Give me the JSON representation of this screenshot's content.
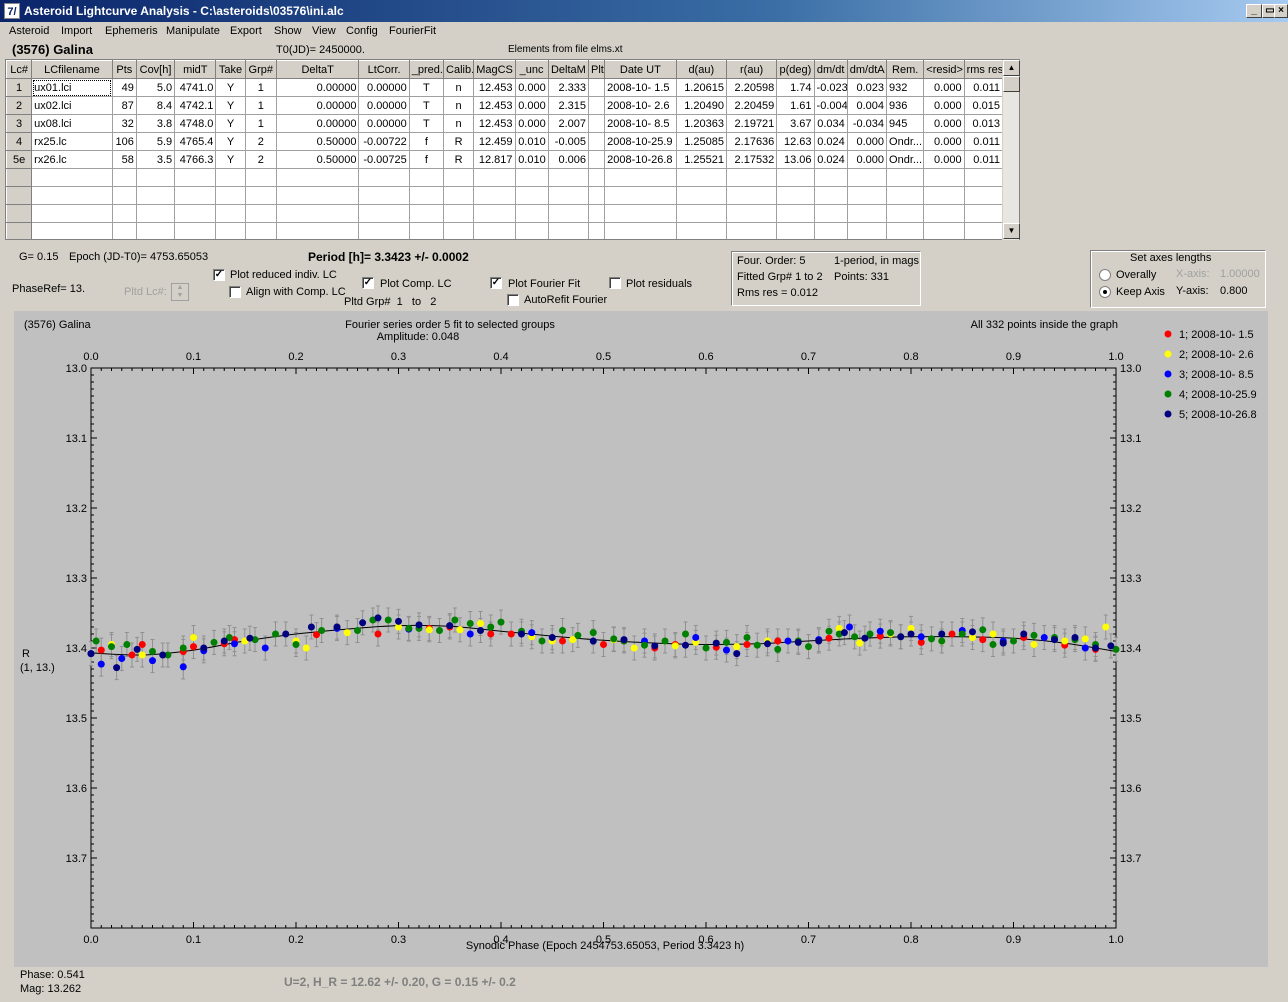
{
  "window": {
    "title": "Asteroid Lightcurve Analysis - C:\\asteroids\\03576\\ini.alc",
    "icon_name": "app-logo-icon"
  },
  "menu": [
    "Asteroid",
    "Import",
    "Ephemeris",
    "Manipulate",
    "Export",
    "Show",
    "View",
    "Config",
    "FourierFit"
  ],
  "header": {
    "asteroid": "(3576) Galina",
    "t0": "T0(JD)= 2450000.",
    "elements": "Elements from file elms.xt"
  },
  "grid": {
    "columns": [
      "Lc#",
      "LCfilename",
      "Pts",
      "Cov[h]",
      "midT",
      "Take",
      "Grp#",
      "DeltaT",
      "LtCorr.",
      "_pred.",
      "Calib.",
      "MagCS",
      "_unc",
      "DeltaM",
      "Plt",
      "Date UT",
      "d(au)",
      "r(au)",
      "p(deg)",
      "dm/dt",
      "dm/dtA",
      "Rem.",
      "<resid>",
      "rms res"
    ],
    "rows": [
      [
        "1",
        "ux01.lci",
        "49",
        "5.0",
        "4741.0",
        "Y",
        "1",
        "0.00000",
        "0.00000",
        "T",
        "n",
        "12.453",
        "0.000",
        "2.333",
        "",
        "2008-10- 1.5",
        "1.20615",
        "2.20598",
        "1.74",
        "-0.023",
        "0.023",
        "932",
        "0.000",
        "0.011"
      ],
      [
        "2",
        "ux02.lci",
        "87",
        "8.4",
        "4742.1",
        "Y",
        "1",
        "0.00000",
        "0.00000",
        "T",
        "n",
        "12.453",
        "0.000",
        "2.315",
        "",
        "2008-10- 2.6",
        "1.20490",
        "2.20459",
        "1.61",
        "-0.004",
        "0.004",
        "936",
        "0.000",
        "0.015"
      ],
      [
        "3",
        "ux08.lci",
        "32",
        "3.8",
        "4748.0",
        "Y",
        "1",
        "0.00000",
        "0.00000",
        "T",
        "n",
        "12.453",
        "0.000",
        "2.007",
        "",
        "2008-10- 8.5",
        "1.20363",
        "2.19721",
        "3.67",
        "0.034",
        "-0.034",
        "945",
        "0.000",
        "0.013"
      ],
      [
        "4",
        "rx25.lc",
        "106",
        "5.9",
        "4765.4",
        "Y",
        "2",
        "0.50000",
        "-0.00722",
        "f",
        "R",
        "12.459",
        "0.010",
        "-0.005",
        "",
        "2008-10-25.9",
        "1.25085",
        "2.17636",
        "12.63",
        "0.024",
        "0.000",
        "Ondr...",
        "0.000",
        "0.011"
      ],
      [
        "5e",
        "rx26.lc",
        "58",
        "3.5",
        "4766.3",
        "Y",
        "2",
        "0.50000",
        "-0.00725",
        "f",
        "R",
        "12.817",
        "0.010",
        "0.006",
        "",
        "2008-10-26.8",
        "1.25521",
        "2.17532",
        "13.06",
        "0.024",
        "0.000",
        "Ondr...",
        "0.000",
        "0.011"
      ]
    ],
    "empty_rows": 4
  },
  "info": {
    "g": "G= 0.15",
    "epoch": "Epoch (JD-T0)= 4753.65053",
    "period": "Period [h]= 3.3423 +/- 0.0002",
    "phase_ref": "PhaseRef= 13.",
    "pltd_lc": "Pltd Lc#:",
    "pltd_grp": "Pltd Grp#",
    "pltd_grp_from": "1",
    "pltd_grp_to_label": "to",
    "pltd_grp_to": "2"
  },
  "options": {
    "plot_reduced": {
      "label": "Plot reduced indiv. LC",
      "checked": true
    },
    "align_comp": {
      "label": "Align with Comp. LC",
      "checked": false
    },
    "plot_comp": {
      "label": "Plot Comp. LC",
      "checked": true
    },
    "plot_fourier": {
      "label": "Plot Fourier Fit",
      "checked": true
    },
    "autorefit": {
      "label": "AutoRefit Fourier",
      "checked": false
    },
    "plot_residuals": {
      "label": "Plot residuals",
      "checked": false
    }
  },
  "fourier_box": {
    "order": "Four. Order:  5",
    "mode": "1-period, in mags",
    "fitted": "Fitted Grp# 1 to 2",
    "points": "Points: 331",
    "rms": "Rms res     = 0.012"
  },
  "axes_box": {
    "title": "Set axes lengths",
    "overally": "Overally",
    "keep_axis": "Keep Axis",
    "selected": "Keep Axis",
    "x_axis_label": "X-axis:",
    "x_axis_value": "1.00000",
    "y_axis_label": "Y-axis:",
    "y_axis_value": "0.800"
  },
  "chart_data": {
    "type": "scatter",
    "title": "Fourier series order 5 fit to selected groups",
    "subtitle": "Amplitude: 0.048",
    "top_left_label": "(3576) Galina",
    "top_right_label": "All 332 points inside the graph",
    "xlabel": "Synodic Phase (Epoch 2454753.65053, Period 3.3423 h)",
    "ylabel": "R",
    "ylabel2": "(1, 13.)",
    "xlim": [
      0,
      1
    ],
    "ylim": [
      13.0,
      13.8
    ],
    "y_inverted": true,
    "xticks": [
      "0.0",
      "0.1",
      "0.2",
      "0.3",
      "0.4",
      "0.5",
      "0.6",
      "0.7",
      "0.8",
      "0.9",
      "1.0"
    ],
    "yticks": [
      "13.0",
      "13.1",
      "13.2",
      "13.3",
      "13.4",
      "13.5",
      "13.6",
      "13.7"
    ],
    "grid": false,
    "background": "#c0c0c0",
    "legend_position": "right",
    "series": [
      {
        "name": "1; 2008-10- 1.5",
        "color": "#ff0000",
        "x": [
          0.01,
          0.04,
          0.05,
          0.09,
          0.1,
          0.13,
          0.14,
          0.22,
          0.28,
          0.33,
          0.35,
          0.39,
          0.41,
          0.46,
          0.5,
          0.52,
          0.55,
          0.57,
          0.61,
          0.64,
          0.67,
          0.72,
          0.77,
          0.81,
          0.84,
          0.87,
          0.91,
          0.95,
          0.98
        ],
        "y": [
          13.403,
          13.41,
          13.395,
          13.405,
          13.398,
          13.394,
          13.388,
          13.381,
          13.38,
          13.372,
          13.37,
          13.38,
          13.38,
          13.39,
          13.395,
          13.39,
          13.4,
          13.395,
          13.399,
          13.395,
          13.39,
          13.386,
          13.383,
          13.392,
          13.38,
          13.388,
          13.385,
          13.396,
          13.402
        ]
      },
      {
        "name": "2; 2008-10- 2.6",
        "color": "#ffff00",
        "x": [
          0.02,
          0.05,
          0.1,
          0.15,
          0.2,
          0.21,
          0.25,
          0.3,
          0.33,
          0.36,
          0.38,
          0.43,
          0.45,
          0.47,
          0.51,
          0.53,
          0.57,
          0.59,
          0.63,
          0.66,
          0.7,
          0.73,
          0.75,
          0.78,
          0.8,
          0.83,
          0.86,
          0.88,
          0.92,
          0.95,
          0.97,
          0.99
        ],
        "y": [
          13.395,
          13.41,
          13.385,
          13.39,
          13.39,
          13.4,
          13.378,
          13.37,
          13.374,
          13.374,
          13.365,
          13.384,
          13.39,
          13.388,
          13.388,
          13.4,
          13.397,
          13.392,
          13.398,
          13.39,
          13.398,
          13.372,
          13.393,
          13.38,
          13.372,
          13.39,
          13.385,
          13.38,
          13.395,
          13.39,
          13.387,
          13.37
        ]
      },
      {
        "name": "3; 2008-10- 8.5",
        "color": "#0000ff",
        "x": [
          0.0,
          0.01,
          0.03,
          0.06,
          0.09,
          0.11,
          0.14,
          0.17,
          0.24,
          0.31,
          0.37,
          0.43,
          0.54,
          0.59,
          0.62,
          0.68,
          0.71,
          0.74,
          0.77,
          0.81,
          0.85,
          0.89,
          0.93,
          0.97
        ],
        "y": [
          13.408,
          13.423,
          13.415,
          13.418,
          13.427,
          13.404,
          13.394,
          13.4,
          13.372,
          13.373,
          13.38,
          13.378,
          13.39,
          13.385,
          13.403,
          13.39,
          13.388,
          13.37,
          13.376,
          13.384,
          13.375,
          13.39,
          13.385,
          13.4
        ]
      },
      {
        "name": "4; 2008-10-25.9",
        "color": "#008000",
        "x": [
          0.005,
          0.02,
          0.035,
          0.06,
          0.075,
          0.09,
          0.12,
          0.135,
          0.16,
          0.18,
          0.2,
          0.225,
          0.24,
          0.26,
          0.275,
          0.29,
          0.31,
          0.32,
          0.34,
          0.355,
          0.37,
          0.39,
          0.4,
          0.42,
          0.44,
          0.46,
          0.475,
          0.49,
          0.51,
          0.52,
          0.54,
          0.56,
          0.58,
          0.6,
          0.62,
          0.64,
          0.65,
          0.67,
          0.69,
          0.7,
          0.72,
          0.73,
          0.745,
          0.76,
          0.78,
          0.79,
          0.82,
          0.83,
          0.85,
          0.87,
          0.88,
          0.9,
          0.92,
          0.94,
          0.96,
          0.98,
          1.0
        ],
        "y": [
          13.39,
          13.398,
          13.395,
          13.405,
          13.41,
          13.4,
          13.392,
          13.385,
          13.388,
          13.38,
          13.395,
          13.375,
          13.37,
          13.375,
          13.36,
          13.36,
          13.372,
          13.372,
          13.375,
          13.36,
          13.365,
          13.37,
          13.363,
          13.376,
          13.39,
          13.375,
          13.382,
          13.378,
          13.387,
          13.39,
          13.396,
          13.39,
          13.38,
          13.4,
          13.392,
          13.385,
          13.396,
          13.402,
          13.39,
          13.398,
          13.376,
          13.38,
          13.384,
          13.38,
          13.378,
          13.384,
          13.387,
          13.39,
          13.38,
          13.374,
          13.395,
          13.39,
          13.382,
          13.385,
          13.388,
          13.395,
          13.402
        ]
      },
      {
        "name": "5; 2008-10-26.8",
        "color": "#000080",
        "x": [
          0.0,
          0.025,
          0.045,
          0.07,
          0.11,
          0.13,
          0.155,
          0.19,
          0.215,
          0.24,
          0.265,
          0.28,
          0.3,
          0.32,
          0.35,
          0.38,
          0.42,
          0.45,
          0.49,
          0.52,
          0.55,
          0.58,
          0.61,
          0.63,
          0.66,
          0.69,
          0.71,
          0.735,
          0.755,
          0.79,
          0.8,
          0.83,
          0.86,
          0.89,
          0.91,
          0.94,
          0.96,
          0.98,
          0.995
        ],
        "y": [
          13.408,
          13.428,
          13.402,
          13.41,
          13.4,
          13.39,
          13.386,
          13.38,
          13.37,
          13.37,
          13.364,
          13.357,
          13.362,
          13.367,
          13.368,
          13.375,
          13.38,
          13.385,
          13.39,
          13.388,
          13.397,
          13.396,
          13.393,
          13.408,
          13.394,
          13.392,
          13.39,
          13.378,
          13.386,
          13.384,
          13.38,
          13.38,
          13.377,
          13.393,
          13.38,
          13.388,
          13.385,
          13.4,
          13.397
        ]
      }
    ],
    "fit": {
      "name": "Fourier fit",
      "color": "#000000",
      "x": [
        0,
        0.05,
        0.1,
        0.15,
        0.2,
        0.25,
        0.3,
        0.35,
        0.4,
        0.45,
        0.5,
        0.55,
        0.6,
        0.65,
        0.7,
        0.75,
        0.8,
        0.85,
        0.9,
        0.95,
        1.0
      ],
      "y": [
        13.407,
        13.41,
        13.403,
        13.39,
        13.38,
        13.373,
        13.368,
        13.369,
        13.376,
        13.383,
        13.389,
        13.393,
        13.395,
        13.394,
        13.39,
        13.386,
        13.384,
        13.384,
        13.386,
        13.393,
        13.405
      ]
    }
  },
  "status": {
    "phase": "Phase:  0.541",
    "mag": "Mag:   13.262",
    "result": "U=2, H_R = 12.62 +/- 0.20, G = 0.15 +/- 0.2"
  }
}
